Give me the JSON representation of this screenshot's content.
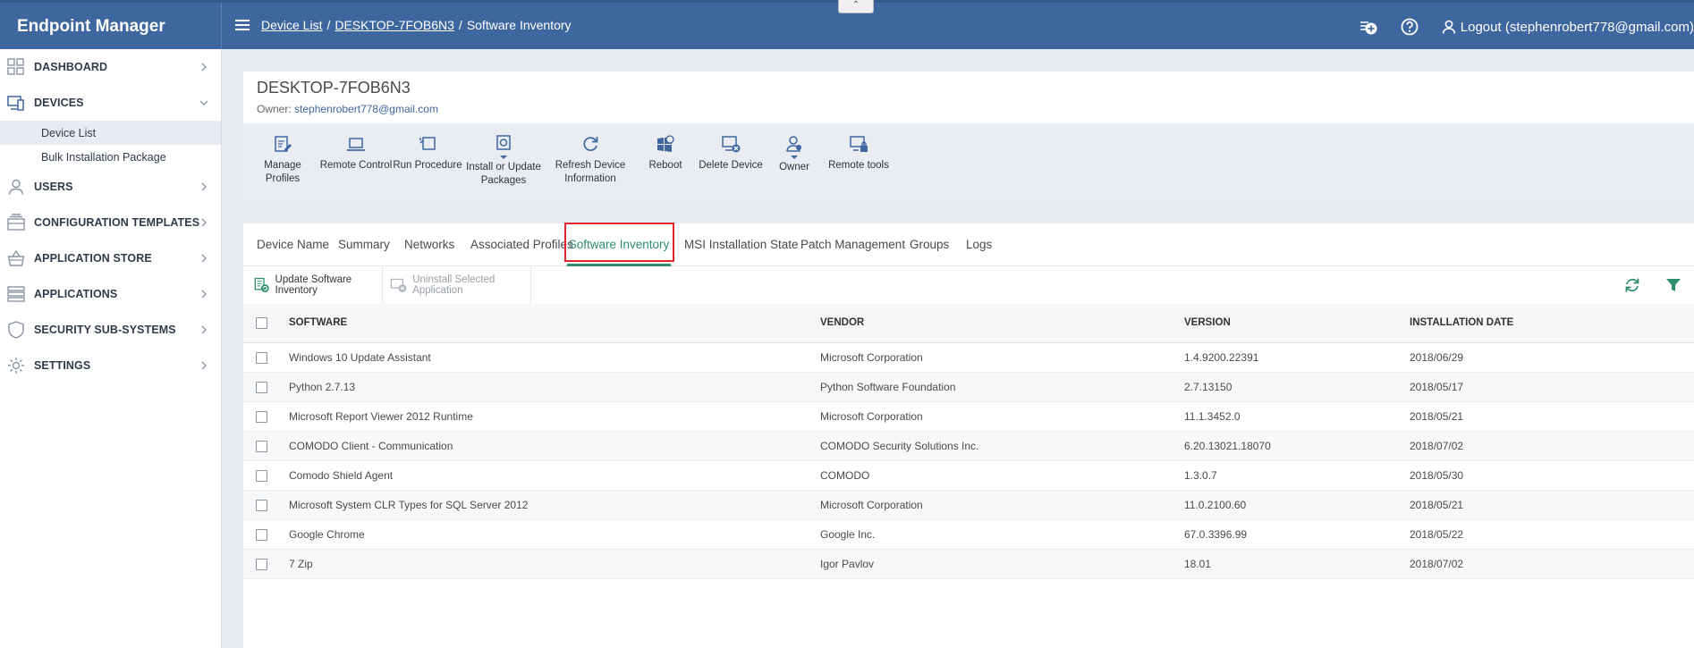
{
  "app": {
    "title": "Endpoint Manager"
  },
  "breadcrumb": {
    "item1": "Device List",
    "item2": "DESKTOP-7FOB6N3",
    "current": "Software Inventory",
    "sep": "/"
  },
  "topbar": {
    "collapse_glyph": "⌃",
    "logout_label": "Logout (stephenrobert778@gmail.com)"
  },
  "sidebar": {
    "items": [
      {
        "label": "DASHBOARD",
        "icon": "dashboard-icon"
      },
      {
        "label": "DEVICES",
        "icon": "devices-icon",
        "expanded": true
      },
      {
        "label": "USERS",
        "icon": "user-icon"
      },
      {
        "label": "CONFIGURATION TEMPLATES",
        "icon": "template-icon"
      },
      {
        "label": "APPLICATION STORE",
        "icon": "basket-icon"
      },
      {
        "label": "APPLICATIONS",
        "icon": "applications-icon"
      },
      {
        "label": "SECURITY SUB-SYSTEMS",
        "icon": "shield-icon"
      },
      {
        "label": "SETTINGS",
        "icon": "gear-icon"
      }
    ],
    "subitems": [
      {
        "label": "Device List",
        "active": true
      },
      {
        "label": "Bulk Installation Package"
      }
    ]
  },
  "device": {
    "name": "DESKTOP-7FOB6N3",
    "owner_label": "Owner:",
    "owner_email": "stephenrobert778@gmail.com"
  },
  "toolbar": {
    "manage_profiles": "Manage Profiles",
    "remote_control": "Remote Control",
    "run_procedure": "Run Procedure",
    "install_update_1": "Install or Update",
    "install_update_2": "Packages",
    "refresh_info_1": "Refresh Device",
    "refresh_info_2": "Information",
    "reboot": "Reboot",
    "delete_device": "Delete Device",
    "owner": "Owner",
    "remote_tools": "Remote tools"
  },
  "tabs": {
    "device_name": "Device Name",
    "summary": "Summary",
    "networks": "Networks",
    "associated_profiles": "Associated Profiles",
    "software_inventory": "Software Inventory",
    "msi_state": "MSI Installation State",
    "patch_management": "Patch Management",
    "groups": "Groups",
    "logs": "Logs"
  },
  "actions": {
    "update_inventory": "Update Software Inventory",
    "uninstall_selected": "Uninstall Selected Application"
  },
  "table": {
    "headers": {
      "software": "SOFTWARE",
      "vendor": "VENDOR",
      "version": "VERSION",
      "install_date": "INSTALLATION DATE"
    },
    "rows": [
      {
        "software": "Windows 10 Update Assistant",
        "vendor": "Microsoft Corporation",
        "version": "1.4.9200.22391",
        "date": "2018/06/29"
      },
      {
        "software": "Python 2.7.13",
        "vendor": "Python Software Foundation",
        "version": "2.7.13150",
        "date": "2018/05/17"
      },
      {
        "software": "Microsoft Report Viewer 2012 Runtime",
        "vendor": "Microsoft Corporation",
        "version": "11.1.3452.0",
        "date": "2018/05/21"
      },
      {
        "software": "COMODO Client - Communication",
        "vendor": "COMODO Security Solutions Inc.",
        "version": "6.20.13021.18070",
        "date": "2018/07/02"
      },
      {
        "software": "Comodo Shield Agent",
        "vendor": "COMODO",
        "version": "1.3.0.7",
        "date": "2018/05/30"
      },
      {
        "software": "Microsoft System CLR Types for SQL Server 2012",
        "vendor": "Microsoft Corporation",
        "version": "11.0.2100.60",
        "date": "2018/05/21"
      },
      {
        "software": "Google Chrome",
        "vendor": "Google Inc.",
        "version": "67.0.3396.99",
        "date": "2018/05/22"
      },
      {
        "software": "7 Zip",
        "vendor": "Igor Pavlov",
        "version": "18.01",
        "date": "2018/07/02"
      }
    ]
  },
  "colors": {
    "topbar": "#3e67a0",
    "active_tab": "#2e8f6e",
    "highlight": "#e3262b",
    "link": "#3e67a0"
  }
}
